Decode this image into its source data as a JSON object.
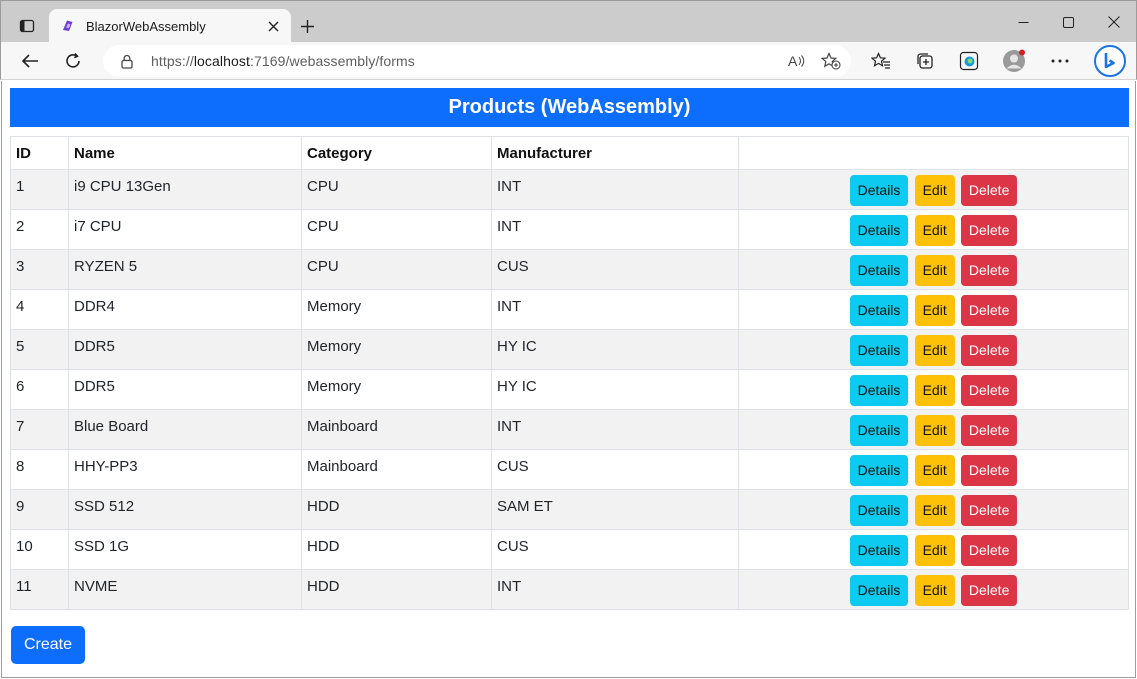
{
  "browser": {
    "tab_title": "BlazorWebAssembly",
    "url_prefix": "https://",
    "url_host": "localhost",
    "url_rest": ":7169/webassembly/forms",
    "icons": [
      "tab-actions-icon",
      "blazor-icon",
      "close-icon",
      "plus-icon",
      "minimize-icon",
      "maximize-icon",
      "window-close-icon",
      "back-icon",
      "refresh-icon",
      "lock-icon",
      "read-aloud-icon",
      "add-favorite-icon",
      "favorites-icon",
      "collections-icon",
      "edge-icon",
      "profile-icon",
      "more-icon",
      "bing-icon"
    ]
  },
  "page": {
    "title": "Products (WebAssembly)",
    "columns": [
      "ID",
      "Name",
      "Category",
      "Manufacturer",
      ""
    ],
    "actions": {
      "details": "Details",
      "edit": "Edit",
      "delete": "Delete"
    },
    "create_label": "Create",
    "products": [
      {
        "id": "1",
        "name": "i9 CPU 13Gen",
        "category": "CPU",
        "manufacturer": "INT"
      },
      {
        "id": "2",
        "name": "i7 CPU",
        "category": "CPU",
        "manufacturer": "INT"
      },
      {
        "id": "3",
        "name": "RYZEN 5",
        "category": "CPU",
        "manufacturer": "CUS"
      },
      {
        "id": "4",
        "name": "DDR4",
        "category": "Memory",
        "manufacturer": "INT"
      },
      {
        "id": "5",
        "name": "DDR5",
        "category": "Memory",
        "manufacturer": "HY IC"
      },
      {
        "id": "6",
        "name": "DDR5",
        "category": "Memory",
        "manufacturer": "HY IC"
      },
      {
        "id": "7",
        "name": "Blue Board",
        "category": "Mainboard",
        "manufacturer": "INT"
      },
      {
        "id": "8",
        "name": "HHY-PP3",
        "category": "Mainboard",
        "manufacturer": "CUS"
      },
      {
        "id": "9",
        "name": "SSD 512",
        "category": "HDD",
        "manufacturer": "SAM ET"
      },
      {
        "id": "10",
        "name": "SSD 1G",
        "category": "HDD",
        "manufacturer": "CUS"
      },
      {
        "id": "11",
        "name": "NVME",
        "category": "HDD",
        "manufacturer": "INT"
      }
    ]
  },
  "colors": {
    "primary": "#0d6efd",
    "info": "#0dcaf0",
    "warning": "#ffc107",
    "danger": "#dc3545",
    "stripe": "#f2f2f2"
  }
}
